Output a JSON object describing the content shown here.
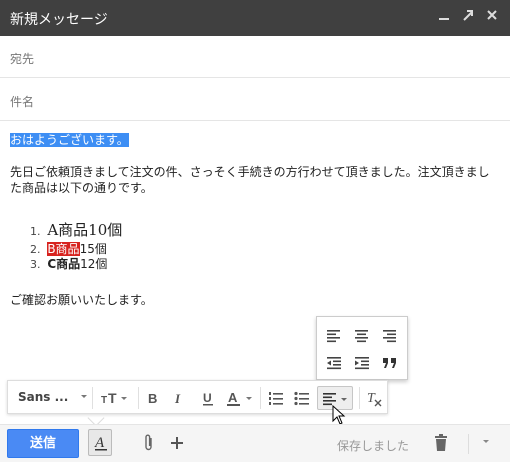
{
  "window": {
    "title": "新規メッセージ"
  },
  "fields": {
    "to_label": "宛先",
    "subject_label": "件名"
  },
  "message": {
    "greeting": "おはようございます。",
    "paragraph": "先日ご依頼頂きまして注文の件、さっそく手続きの方行わせて頂きました。注文頂きました商品は以下の通りです。",
    "list": [
      {
        "num": "1.",
        "name": "A商品",
        "qty": "10個"
      },
      {
        "num": "2.",
        "name": "B商品",
        "qty": "15個"
      },
      {
        "num": "3.",
        "name": "C商品",
        "qty": "12個"
      }
    ],
    "closing": "ご確認お願いいたします。"
  },
  "toolbar": {
    "font_label": "Sans ..."
  },
  "footer": {
    "send_label": "送信",
    "saved_label": "保存しました"
  },
  "colors": {
    "titlebar": "#404040",
    "send_button": "#4a8af4",
    "highlight_blue": "#3d8ef4",
    "highlight_red": "#d7231f"
  }
}
